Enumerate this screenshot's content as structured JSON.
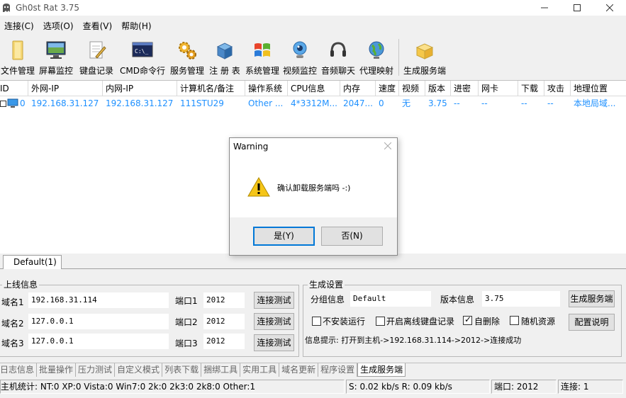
{
  "window": {
    "title": "Gh0st Rat 3.75",
    "min_icon": "minimize-icon",
    "max_icon": "maximize-icon"
  },
  "menu": [
    "连接(C)",
    "选项(O)",
    "查看(V)",
    "帮助(H)"
  ],
  "toolbar": [
    {
      "label": "文件管理",
      "icon": "folder-icon"
    },
    {
      "label": "屏幕监控",
      "icon": "monitor-icon"
    },
    {
      "label": "键盘记录",
      "icon": "notepad-icon"
    },
    {
      "label": "CMD命令行",
      "icon": "cmd-icon"
    },
    {
      "label": "服务管理",
      "icon": "gears-icon"
    },
    {
      "label": "注 册 表",
      "icon": "registry-icon"
    },
    {
      "label": "系统管理",
      "icon": "windows-icon"
    },
    {
      "label": "视频监控",
      "icon": "webcam-icon"
    },
    {
      "label": "音频聊天",
      "icon": "headset-icon"
    },
    {
      "label": "代理映射",
      "icon": "globe-icon"
    },
    {
      "label": "生成服务端",
      "icon": "package-icon"
    }
  ],
  "list": {
    "columns": [
      "ID",
      "外网-IP",
      "内网-IP",
      "计算机名/备注",
      "操作系统",
      "CPU信息",
      "内存",
      "速度",
      "视频",
      "版本",
      "进密",
      "网卡",
      "下载",
      "攻击",
      "地理位置"
    ],
    "rows": [
      [
        "0",
        "192.168.31.127",
        "192.168.31.127",
        "111STU29",
        "Other ...",
        "4*3312M...",
        "2047...",
        "0",
        "无",
        "3.75",
        "--",
        "--",
        "--",
        "--",
        "本地局域..."
      ]
    ]
  },
  "group_tab": "Default(1)",
  "online": {
    "legend": "上线信息",
    "rows": [
      {
        "label": "域名1",
        "host": "192.168.31.114",
        "port_label": "端口1",
        "port": "2012",
        "test": "连接测试"
      },
      {
        "label": "域名2",
        "host": "127.0.0.1",
        "port_label": "端口2",
        "port": "2012",
        "test": "连接测试"
      },
      {
        "label": "域名3",
        "host": "127.0.0.1",
        "port_label": "端口3",
        "port": "2012",
        "test": "连接测试"
      }
    ]
  },
  "build": {
    "legend": "生成设置",
    "group_label": "分组信息",
    "group_value": "Default",
    "version_label": "版本信息",
    "version_value": "3.75",
    "build_button": "生成服务端",
    "config_button": "配置说明",
    "opt_noinstall": "不安装运行",
    "opt_offline": "开启离线键盘记录",
    "opt_selfdelete": "自删除",
    "opt_random": "随机资源",
    "info": "信息提示: 打开到主机->192.168.31.114->2012->连接成功"
  },
  "bottom_tabs": [
    "日志信息",
    "批量操作",
    "压力测试",
    "自定义模式",
    "列表下载",
    "捆绑工具",
    "实用工具",
    "域名更新",
    "程序设置",
    "生成服务端"
  ],
  "status": {
    "stats": "主机统计:  NT:0  XP:0  Vista:0  Win7:0  2k:0  2k3:0  2k8:0  Other:1",
    "speed": "S: 0.02 kb/s R: 0.09 kb/s",
    "port": "端口: 2012",
    "conn": "连接: 1"
  },
  "dialog": {
    "title": "Warning",
    "message": "确认卸载服务端吗 -:)",
    "yes": "是(Y)",
    "no": "否(N)",
    "icon": "warning-icon"
  }
}
